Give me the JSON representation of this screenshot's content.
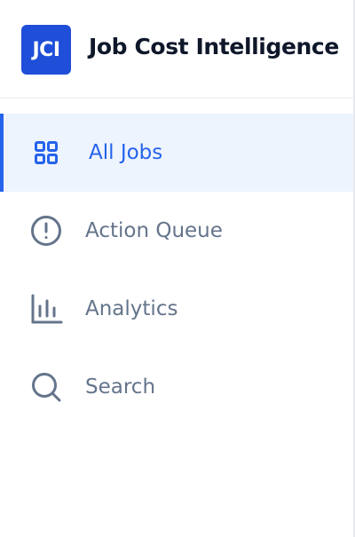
{
  "app": {
    "logo_text": "JCI",
    "title": "Job Cost Intelligence"
  },
  "nav": {
    "items": [
      {
        "label": "All Jobs",
        "icon": "grid-icon",
        "active": true
      },
      {
        "label": "Action Queue",
        "icon": "alert-circle-icon",
        "active": false
      },
      {
        "label": "Analytics",
        "icon": "bar-chart-icon",
        "active": false
      },
      {
        "label": "Search",
        "icon": "search-icon",
        "active": false
      }
    ]
  },
  "colors": {
    "accent": "#2563eb",
    "logo_bg": "#1f4ed8",
    "active_bg": "#eef4fe",
    "inactive_text": "#64748b",
    "title_text": "#0f172a"
  }
}
